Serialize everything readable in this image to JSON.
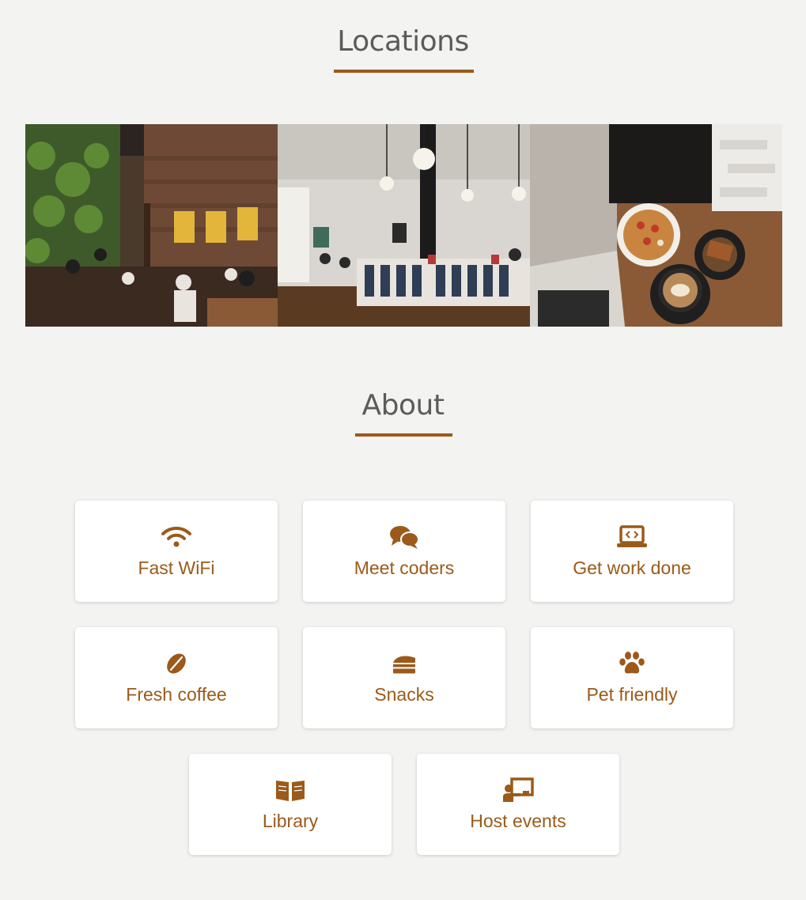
{
  "locations": {
    "title": "Locations",
    "photos": [
      {
        "name": "cafe-interior-green-wall-photo"
      },
      {
        "name": "cafe-counter-pendant-lights-photo"
      },
      {
        "name": "latte-and-bowl-by-window-photo"
      }
    ]
  },
  "about": {
    "title": "About",
    "features": [
      {
        "label": "Fast WiFi",
        "icon": "wifi-icon"
      },
      {
        "label": "Meet coders",
        "icon": "chat-bubbles-icon"
      },
      {
        "label": "Get work done",
        "icon": "laptop-code-icon"
      },
      {
        "label": "Fresh coffee",
        "icon": "coffee-bean-icon"
      },
      {
        "label": "Snacks",
        "icon": "cake-slice-icon"
      },
      {
        "label": "Pet friendly",
        "icon": "paw-icon"
      },
      {
        "label": "Library",
        "icon": "open-book-icon"
      },
      {
        "label": "Host events",
        "icon": "presentation-icon"
      }
    ]
  },
  "colors": {
    "accent": "#9b5a1a",
    "background": "#f3f3f1",
    "heading": "#5b5b5b"
  }
}
